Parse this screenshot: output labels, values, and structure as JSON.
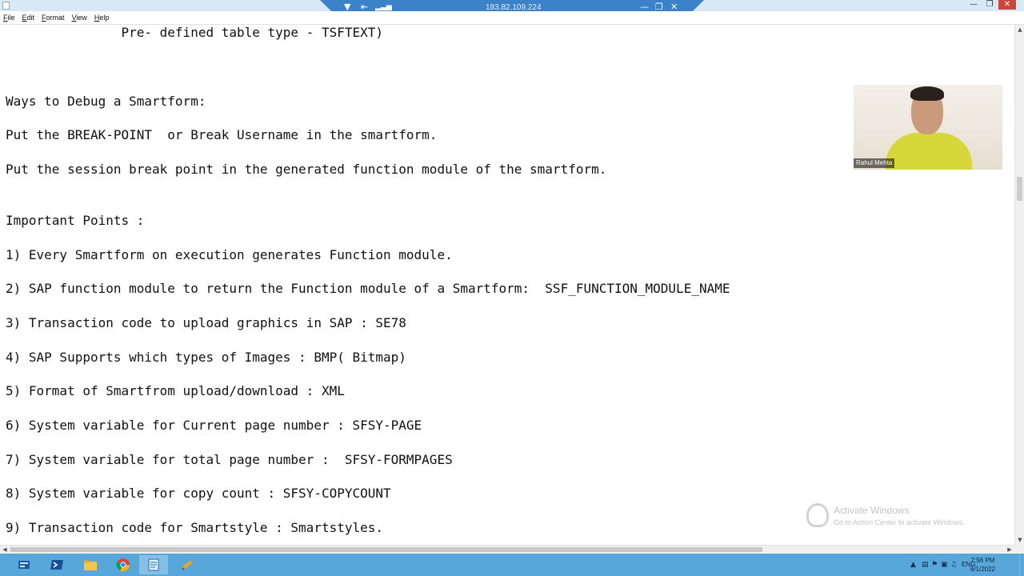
{
  "rdp_bar": {
    "host_ip": "183.82.109.224"
  },
  "menu": [
    "File",
    "Edit",
    "Format",
    "View",
    "Help"
  ],
  "document": {
    "lines": [
      {
        "text": "               Pre- defined table type - TSFTEXT)"
      },
      {
        "text": "Ways to Debug a Smartform:"
      },
      {
        "text": "Put the BREAK-POINT  or Break Username in the smartform."
      },
      {
        "text": "Put the session break point in the generated function module of the smartform."
      },
      {
        "text": "Important Points :"
      },
      {
        "text": "1) Every Smartform on execution generates Function module."
      },
      {
        "text": "2) SAP function module to return the Function module of a Smartform:  SSF_FUNCTION_MODULE_NAME"
      },
      {
        "text": "3) Transaction code to upload graphics in SAP : SE78"
      },
      {
        "text": "4) SAP Supports which types of Images : BMP( Bitmap)"
      },
      {
        "text": "5) Format of Smartfrom upload/download : XML"
      },
      {
        "text": "6) System variable for Current page number : SFSY-PAGE"
      },
      {
        "text": "7) System variable for total page number :  SFSY-FORMPAGES"
      },
      {
        "text": "8) System variable for copy count : SFSY-COPYCOUNT"
      },
      {
        "text": "9) Transaction code for Smartstyle : Smartstyles."
      }
    ]
  },
  "webcam": {
    "name": "Rahul Mehta"
  },
  "watermark": {
    "title": "Activate Windows",
    "subtitle": "Go to Action Center to activate Windows."
  },
  "taskbar": {
    "apps": [
      {
        "icon": "server-manager-icon"
      },
      {
        "icon": "powershell-icon"
      },
      {
        "icon": "file-explorer-icon"
      },
      {
        "icon": "chrome-icon"
      },
      {
        "icon": "notepad-icon"
      },
      {
        "icon": "sap-logon-icon"
      }
    ],
    "language": "ENG",
    "time": "7:56 PM",
    "date": "6/1/2022"
  }
}
